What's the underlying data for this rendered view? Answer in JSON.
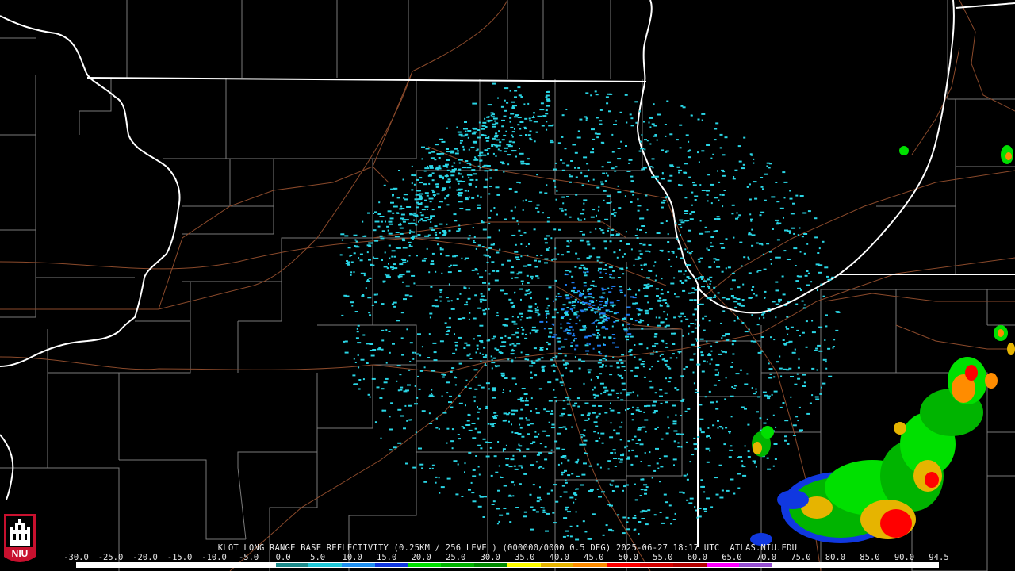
{
  "product": {
    "caption": "KLOT LONG RANGE BASE REFLECTIVITY (0.25KM / 256 LEVEL) (000000/0000 0.5 DEG) 2025-06-27 18:17 UTC  ATLAS.NIU.EDU"
  },
  "scale": {
    "labels": [
      "-30.0",
      "-25.0",
      "-20.0",
      "-15.0",
      "-10.0",
      "-5.0",
      "0.0",
      "5.0",
      "10.0",
      "15.0",
      "20.0",
      "25.0",
      "30.0",
      "35.0",
      "40.0",
      "45.0",
      "50.0",
      "55.0",
      "60.0",
      "65.0",
      "70.0",
      "75.0",
      "80.0",
      "85.0",
      "90.0",
      "94.5"
    ],
    "colors": [
      "#ffffff",
      "#ffffff",
      "#ffffff",
      "#ffffff",
      "#ffffff",
      "#ffffff",
      "#1e8c8c",
      "#20c8d8",
      "#2090f0",
      "#1038e0",
      "#00e000",
      "#00b400",
      "#008c00",
      "#ffff00",
      "#e6b400",
      "#ff8c00",
      "#ff0000",
      "#d20000",
      "#b40000",
      "#ff00ff",
      "#9650d2",
      "#ffffff",
      "#ffffff",
      "#ffffff",
      "#ffffff",
      "#ffffff"
    ]
  },
  "logo": {
    "text": "NIU",
    "colors": {
      "red": "#c8102e",
      "white": "#ffffff",
      "black": "#000000"
    }
  },
  "map_colors": {
    "state_border": "#ffffff",
    "county_border": "#7a7a7a",
    "roads": "#8b4a2b",
    "low_echo": "#2ad6e6",
    "mid_echo": "#1e7cf0"
  }
}
